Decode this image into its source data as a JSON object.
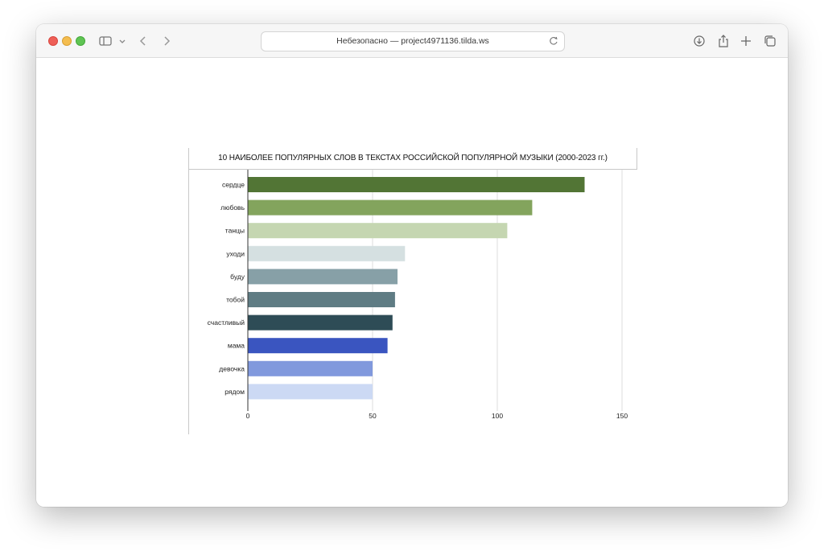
{
  "browser": {
    "address_text": "Небезопасно — project4971136.tilda.ws",
    "icons": [
      "sidebar-icon",
      "chevron-down-icon",
      "back-icon",
      "forward-icon",
      "reload-icon",
      "download-icon",
      "share-icon",
      "new-tab-icon",
      "tab-overview-icon"
    ]
  },
  "chart_data": {
    "type": "bar",
    "orientation": "horizontal",
    "title": "10 НАИБОЛЕЕ ПОПУЛЯРНЫХ СЛОВ В ТЕКСТАХ РОССИЙСКОЙ ПОПУЛЯРНОЙ МУЗЫКИ (2000-2023 гг.)",
    "xlabel": "",
    "ylabel": "",
    "categories": [
      "сердце",
      "любовь",
      "танцы",
      "уходи",
      "буду",
      "тобой",
      "счастливый",
      "мама",
      "девочка",
      "рядом"
    ],
    "values": [
      135,
      114,
      104,
      63,
      60,
      59,
      58,
      56,
      50,
      50
    ],
    "colors": [
      "#527535",
      "#83a45d",
      "#c5d6b1",
      "#d5e0e1",
      "#87a0a7",
      "#5f7c84",
      "#2e4c56",
      "#3a55c0",
      "#8199dd",
      "#ccd9f4"
    ],
    "xlim": [
      0,
      150
    ],
    "xticks": [
      "0",
      "50",
      "100",
      "150"
    ],
    "grid": true,
    "legend": "none"
  }
}
